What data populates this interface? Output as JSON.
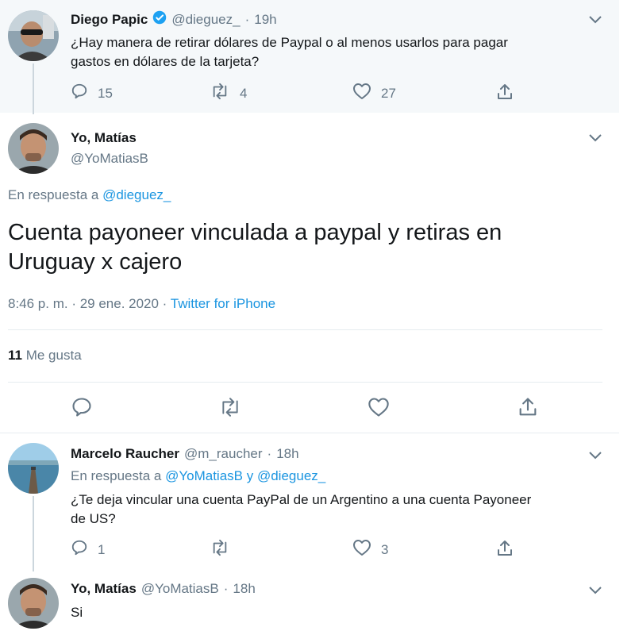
{
  "tweets": {
    "parent": {
      "name": "Diego Papic",
      "handle": "@dieguez_",
      "time": "19h",
      "text_line1": "¿Hay manera de retirar dólares de Paypal o al menos usarlos para pagar",
      "text_line2": "gastos en dólares de la tarjeta?",
      "replies": "15",
      "retweets": "4",
      "likes": "27"
    },
    "main": {
      "name": "Yo, Matías",
      "handle": "@YoMatiasB",
      "reply_prefix": "En respuesta a",
      "reply_to": "@dieguez_",
      "text_line1": "Cuenta payoneer vinculada a paypal y retiras en",
      "text_line2": "Uruguay x cajero",
      "timestamp": "8:46 p. m. · 29 ene. 2020 ·",
      "source": "Twitter for iPhone",
      "likes_count": "11",
      "likes_label": "Me gusta"
    },
    "reply1": {
      "name": "Marcelo Raucher",
      "handle": "@m_raucher",
      "time": "18h",
      "reply_prefix": "En respuesta a",
      "reply_to_1": "@YoMatiasB",
      "reply_and": "y",
      "reply_to_2": "@dieguez_",
      "text_line1": "¿Te deja vincular una cuenta PayPal de un Argentino a una cuenta Payoneer",
      "text_line2": "de US?",
      "replies": "1",
      "likes": "3"
    },
    "reply2": {
      "name": "Yo, Matías",
      "handle": "@YoMatiasB",
      "time": "18h",
      "text": "Si"
    }
  },
  "colors": {
    "accent": "#1b95e0",
    "muted": "#657786",
    "verified": "#1da1f2",
    "parent_bg": "#f5f8fa"
  },
  "icons": [
    "reply-icon",
    "retweet-icon",
    "like-icon",
    "share-icon",
    "verified-badge-icon",
    "chevron-down-icon"
  ]
}
